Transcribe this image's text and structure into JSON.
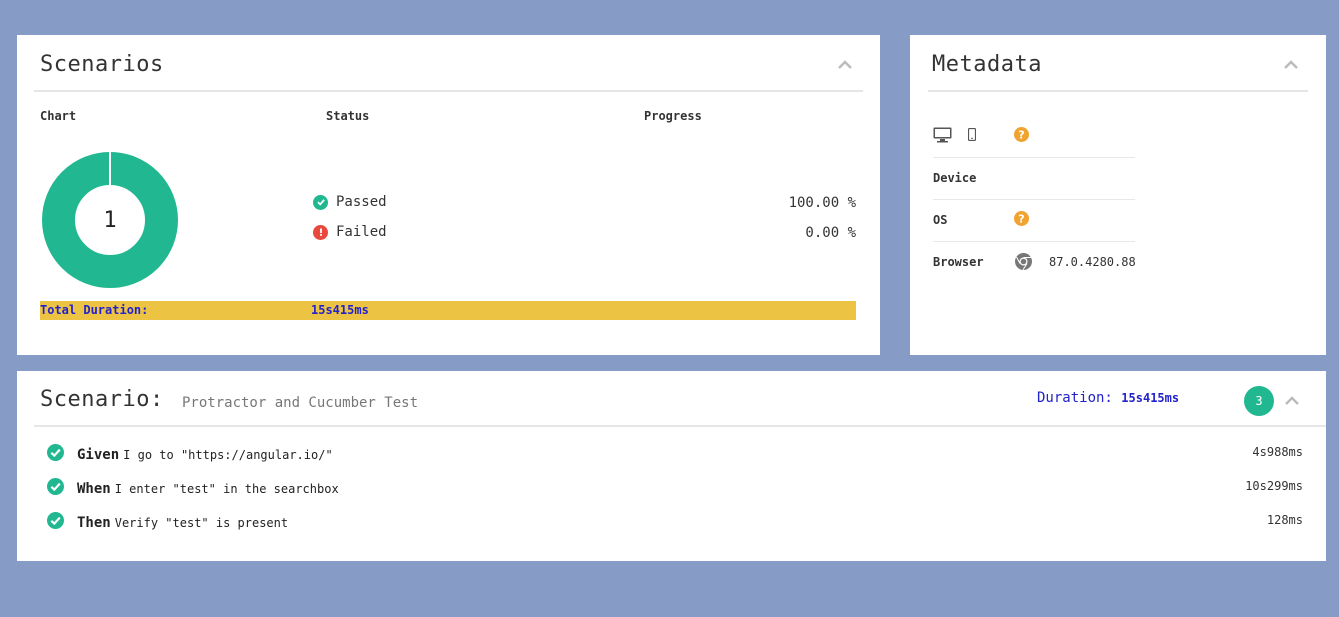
{
  "colors": {
    "background": "#869cc7",
    "passed": "#21b891",
    "failed": "#e8493c",
    "warning": "#f0a330",
    "duration_bar": "#ecc343",
    "duration_text": "#2222cc"
  },
  "scenarios_panel": {
    "title": "Scenarios",
    "col_chart": "Chart",
    "col_status": "Status",
    "col_progress": "Progress",
    "chart_center_value": "1",
    "status_rows": [
      {
        "label": "Passed",
        "progress": "100.00 %",
        "icon": "check-circle-icon"
      },
      {
        "label": "Failed",
        "progress": "0.00 %",
        "icon": "exclamation-circle-icon"
      }
    ],
    "total_duration_label": "Total Duration:",
    "total_duration_value": "15s415ms"
  },
  "chart_data": {
    "type": "pie",
    "categories": [
      "Passed",
      "Failed"
    ],
    "values": [
      1,
      0
    ]
  },
  "metadata_panel": {
    "title": "Metadata",
    "icons": [
      "desktop-icon",
      "mobile-icon",
      "question-icon"
    ],
    "rows": [
      {
        "label": "Device",
        "icon": "",
        "value": ""
      },
      {
        "label": "OS",
        "icon": "question-icon",
        "value": ""
      },
      {
        "label": "Browser",
        "icon": "chrome-icon",
        "value": "87.0.4280.88"
      }
    ]
  },
  "scenario_panel": {
    "title": "Scenario:",
    "name": "Protractor and Cucumber Test",
    "duration_label": "Duration:",
    "duration_value": "15s415ms",
    "steps_count": "3",
    "steps": [
      {
        "keyword": "Given",
        "text": "I go to \"https://angular.io/\"",
        "duration": "4s988ms"
      },
      {
        "keyword": "When",
        "text": "I enter \"test\" in the searchbox",
        "duration": "10s299ms"
      },
      {
        "keyword": "Then",
        "text": "Verify \"test\" is present",
        "duration": "128ms"
      }
    ]
  }
}
